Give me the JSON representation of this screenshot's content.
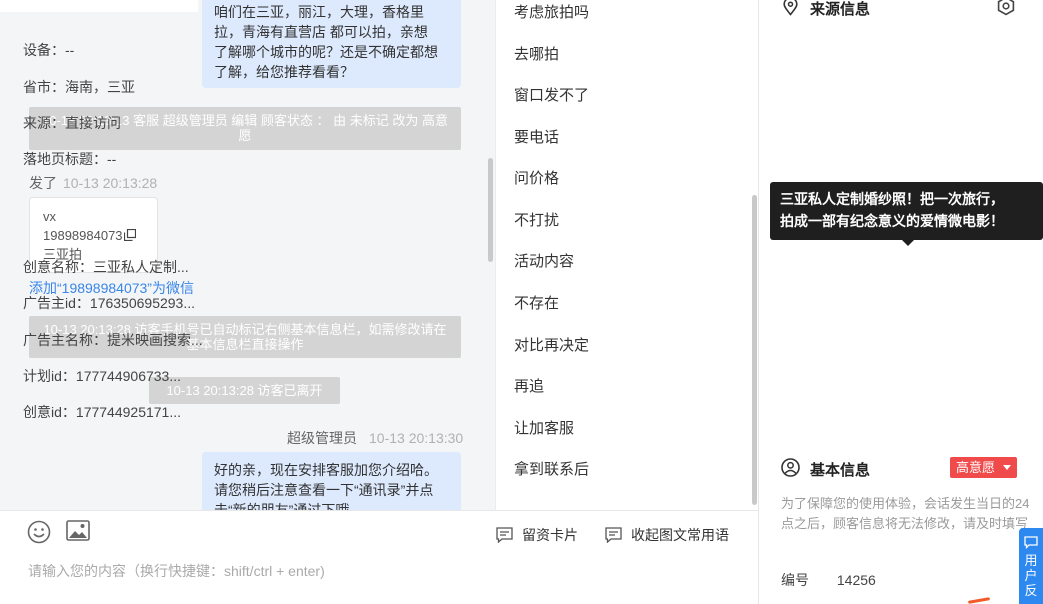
{
  "chat": {
    "msg_top_lines": [
      "咱们在三亚，丽江，大理，香格里",
      "拉，青海有直营店 都可以拍，亲想",
      "了解哪个城市的呢？还是不确定都想",
      "了解，给您推荐看看？"
    ],
    "sys_status": "10-13 20:13:13 客服 超级管理员 编辑 顾客状态 ： 由 未标记 改为 高意愿",
    "visitor_label": "发了",
    "visitor_time": "10-13 20:13:28",
    "contact_card": {
      "line1": "vx",
      "number": "19898984073",
      "line3": "三亚拍"
    },
    "add_wechat_link": "添加“19898984073”为微信",
    "sys_auto": "10-13 20:13:28 访客手机号已自动标记右侧基本信息栏，如需修改请在基本信息栏直接操作",
    "sys_left": "10-13 20:13:28 访客已离开",
    "agent_name": "超级管理员",
    "agent_time": "10-13 20:13:30",
    "msg_bottom_lines": [
      "好的亲，现在安排客服加您介绍哈。",
      "请您稍后注意查看一下“通讯录”并点",
      "击“新的朋友”通过下哦"
    ]
  },
  "input": {
    "placeholder": "请输入您的内容（换行快捷键：shift/ctrl + enter)",
    "card_btn": "留资卡片",
    "phrase_btn": "收起图文常用语"
  },
  "quick_replies": [
    "考虑旅拍吗",
    "去哪拍",
    "窗口发不了",
    "要电话",
    "问价格",
    "不打扰",
    "活动内容",
    "不存在",
    "对比再决定",
    "再追",
    "让加客服",
    "拿到联系后"
  ],
  "info": {
    "source_title": "来源信息",
    "rows": [
      {
        "label": "设备：",
        "value": "--"
      },
      {
        "label": "省市：",
        "value": "海南，三亚"
      },
      {
        "label": "来源：",
        "value": "直接访问"
      },
      {
        "label": "落地页标题：",
        "value": "--"
      }
    ],
    "tooltip_lines": [
      "三亚私人定制婚纱照！把一次旅行，",
      "拍成一部有纪念意义的爱情微电影！"
    ],
    "ad_rows": [
      {
        "label": "创意名称：",
        "value": "三亚私人定制..."
      },
      {
        "label": "广告主id：",
        "value": "176350695293..."
      },
      {
        "label": "广告主名称：",
        "value": "提米映画搜索..."
      },
      {
        "label": "计划id：",
        "value": "177744906733..."
      },
      {
        "label": "创意id：",
        "value": "177744925171..."
      }
    ],
    "basic_title": "基本信息",
    "intent_tag": "高意愿",
    "basic_note": "为了保障您的使用体验，会话发生当日的24点之后，顾客信息将无法修改，请及时填写",
    "id_label": "编号",
    "id_value": "14256",
    "feedback_label": "用户反"
  }
}
